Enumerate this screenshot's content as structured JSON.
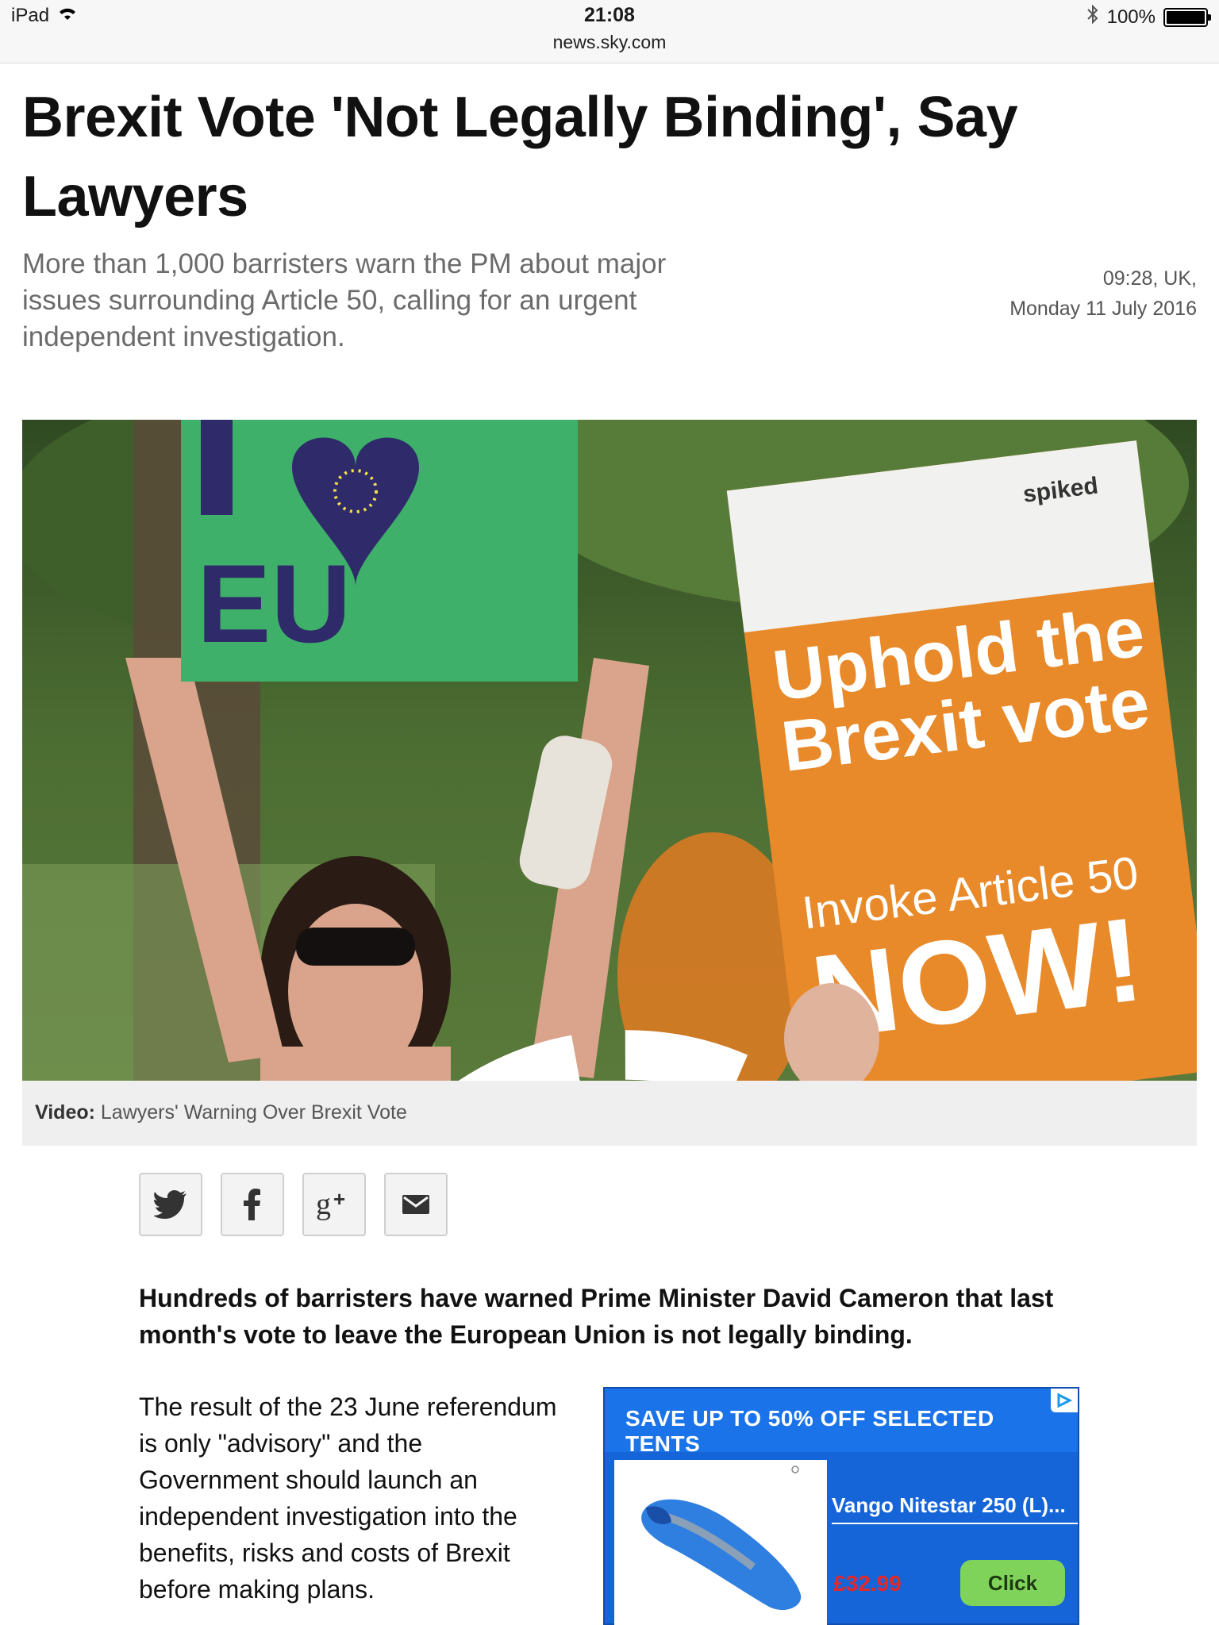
{
  "status_bar": {
    "device": "iPad",
    "time": "21:08",
    "url": "news.sky.com",
    "battery": "100%",
    "battery_level": 1.0
  },
  "article": {
    "headline": "Brexit Vote 'Not Legally Binding', Say Lawyers",
    "standfirst": "More than 1,000 barristers warn the PM about major issues surrounding Article 50, calling for an urgent independent investigation.",
    "date_time": "09:28, UK,",
    "date_day": "Monday 11 July 2016",
    "hero": {
      "sign_left_text_top": "I",
      "sign_left_text_bottom": "EU",
      "sign_right_brand": "spiked",
      "sign_right_line1": "Uphold the",
      "sign_right_line2": "Brexit vote",
      "sign_right_line3": "Invoke Article 50",
      "sign_right_line4": "NOW!"
    },
    "caption_label": "Video:",
    "caption_text": "Lawyers' Warning Over Brexit Vote",
    "lead": "Hundreds of barristers have warned Prime Minister David Cameron that last month's vote to leave the European Union is not legally binding.",
    "paragraph": "The result of the 23 June referendum is only \"advisory\" and the Government should launch an independent investigation into the benefits, risks and costs of Brexit before making plans."
  },
  "share": {
    "icons": [
      "twitter-icon",
      "facebook-icon",
      "google-plus-icon",
      "email-icon"
    ]
  },
  "ad": {
    "headline": "SAVE UP TO 50% OFF SELECTED TENTS",
    "product": "Vango Nitestar 250 (L)...",
    "price": "£32.99",
    "cta": "Click"
  },
  "colors": {
    "ad_blue": "#1a73e8",
    "ad_price": "#e3282a",
    "ad_cta": "#7fd35a",
    "sign_orange": "#e8892a",
    "sign_green": "#3fb06a"
  }
}
